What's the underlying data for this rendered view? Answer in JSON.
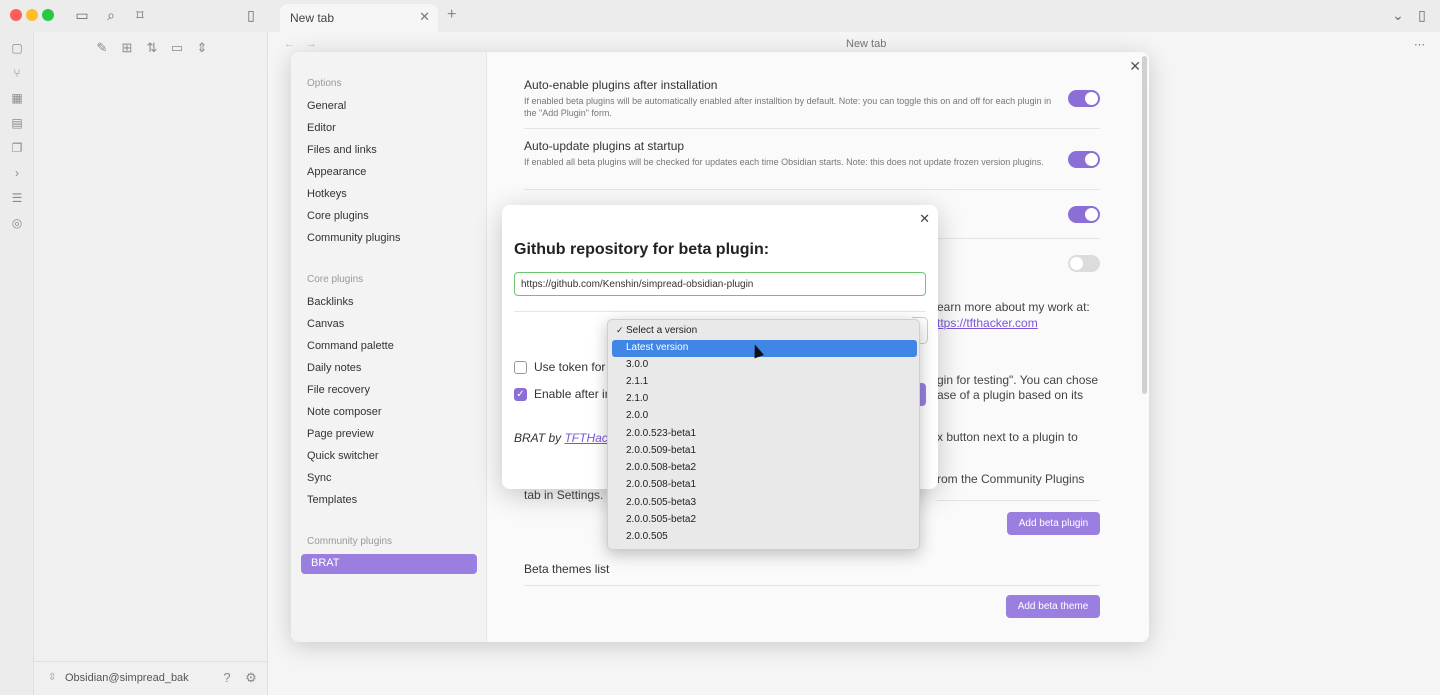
{
  "titlebar": {
    "tab_label": "New tab",
    "tab_close": "✕",
    "tab_add": "+"
  },
  "workspace": {
    "title": "New tab",
    "back": "←",
    "forward": "→",
    "more": "⋯"
  },
  "vault": {
    "name": "Obsidian@simpread_bak"
  },
  "settings": {
    "close": "✕",
    "nav_options_heading": "Options",
    "nav_options": [
      "General",
      "Editor",
      "Files and links",
      "Appearance",
      "Hotkeys",
      "Core plugins",
      "Community plugins"
    ],
    "nav_core_heading": "Core plugins",
    "nav_core": [
      "Backlinks",
      "Canvas",
      "Command palette",
      "Daily notes",
      "File recovery",
      "Note composer",
      "Page preview",
      "Quick switcher",
      "Sync",
      "Templates"
    ],
    "nav_community_heading": "Community plugins",
    "nav_active": "BRAT",
    "options": [
      {
        "title": "Auto-enable plugins after installation",
        "desc": "If enabled beta plugins will be automatically enabled after installtion by default. Note: you can toggle this on and off for each plugin in the \"Add Plugin\" form.",
        "enabled": true
      },
      {
        "title": "Auto-update plugins at startup",
        "desc": "If enabled all beta plugins will be checked for updates each time Obsidian starts. Note: this does not update frozen version plugins.",
        "enabled": true
      }
    ],
    "toggle3_enabled": true,
    "toggle4_enabled": false,
    "bg_learn": "earn more about my work at:",
    "bg_link": "ttps://tfthacker.com",
    "bg_line1": "gin for testing\". You can chose",
    "bg_line2": "ase of a plugin based on its",
    "bg_line3": "x button next to a plugin to",
    "bg_line4": "rom the Community Plugins",
    "bg_tab_settings": "tab in Settings.",
    "add_beta_plugin": "Add beta plugin",
    "beta_themes_title": "Beta themes list",
    "add_beta_theme": "Add beta theme"
  },
  "github_modal": {
    "title": "Github repository for beta plugin:",
    "repo_value": "https://github.com/Kenshin/simpread-obsidian-plugin",
    "use_token_label": "Use token for",
    "use_token_checked": false,
    "enable_after_label": "Enable after in",
    "enable_after_checked": true,
    "footer_prefix": "BRAT by ",
    "footer_link": "TFTHack",
    "close": "✕"
  },
  "version_select": {
    "selected_label": "Select a version",
    "highlighted": "Latest version",
    "options": [
      "Select a version",
      "Latest version",
      "3.0.0",
      "2.1.1",
      "2.1.0",
      "2.0.0",
      "2.0.0.523-beta1",
      "2.0.0.509-beta1",
      "2.0.0.508-beta2",
      "2.0.0.508-beta1",
      "2.0.0.505-beta3",
      "2.0.0.505-beta2",
      "2.0.0.505"
    ]
  }
}
